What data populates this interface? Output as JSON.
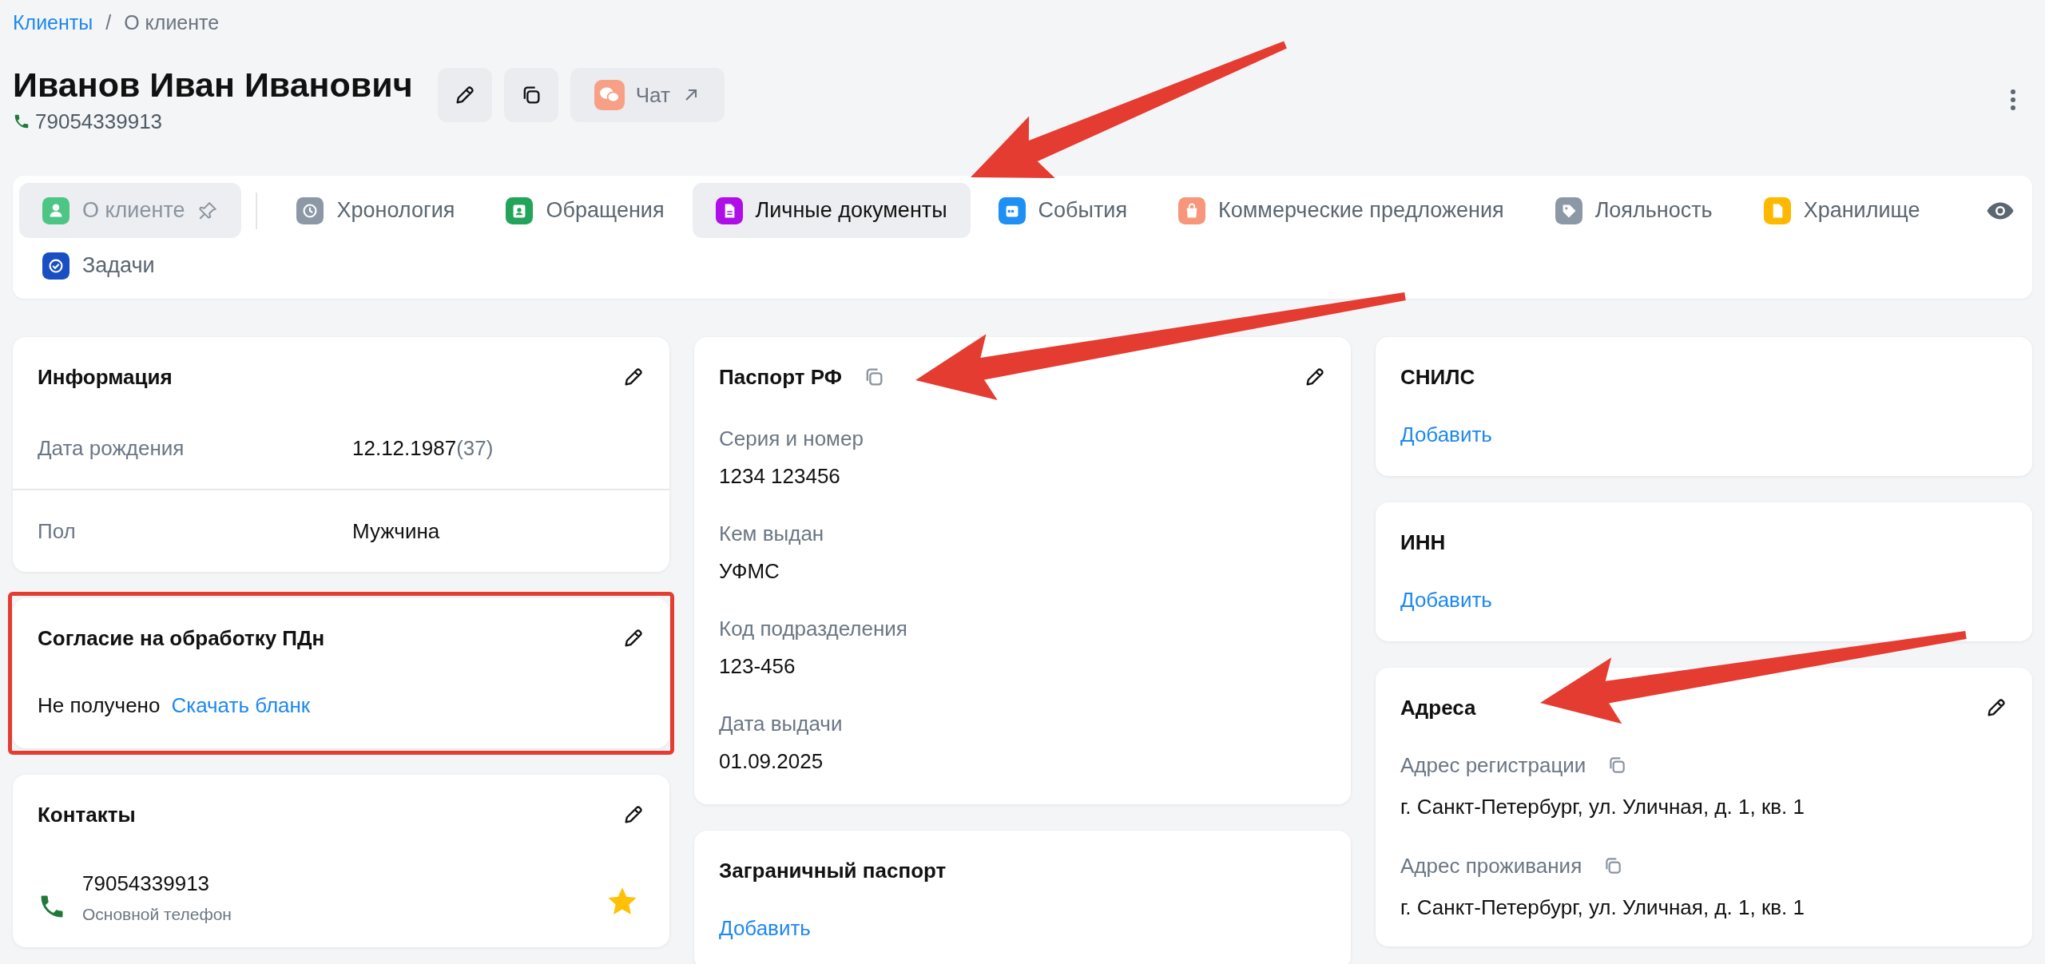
{
  "breadcrumbs": [
    {
      "label": "Клиенты",
      "kind": "link"
    },
    {
      "label": "/",
      "kind": "separator"
    },
    {
      "label": "О клиенте",
      "kind": "current"
    }
  ],
  "client": {
    "name": "Иванов Иван Иванович",
    "phone": "79054339913"
  },
  "header_actions": {
    "chat_label": "Чат"
  },
  "tab_rows": [
    [
      {
        "label": "О клиенте",
        "color": "#4cc585",
        "selected": false,
        "pinned": true
      },
      {
        "label": "Хронология",
        "color": "#8c98a6",
        "selected": false,
        "pinned": false
      },
      {
        "label": "Обращения",
        "color": "#22a45a",
        "selected": false,
        "pinned": false
      },
      {
        "label": "Личные документы",
        "color": "#b00ee8",
        "selected": true,
        "pinned": false
      },
      {
        "label": "События",
        "color": "#1e8ff5",
        "selected": false,
        "pinned": false
      },
      {
        "label": "Коммерческие предложения",
        "color": "#f7967a",
        "selected": false,
        "pinned": false
      },
      {
        "label": "Лояльность",
        "color": "#8c98a6",
        "selected": false,
        "pinned": false
      },
      {
        "label": "Хранилище",
        "color": "#ffb800",
        "selected": false,
        "pinned": false
      }
    ],
    [
      {
        "label": "Задачи",
        "color": "#1a4fc4",
        "selected": false,
        "pinned": false
      }
    ]
  ],
  "columns": [
    [
      {
        "kind": "info",
        "title": "Информация",
        "editable": true,
        "annotated": false,
        "rows": [
          {
            "label": "Дата рождения",
            "value": "12.12.1987",
            "note": "(37)"
          },
          {
            "label": "Пол",
            "value": "Мужчина"
          }
        ]
      },
      {
        "kind": "consent",
        "title": "Согласие на обработку ПДн",
        "editable": true,
        "annotated": true,
        "status": "Не получено",
        "link": "Скачать бланк"
      },
      {
        "kind": "contacts",
        "title": "Контакты",
        "editable": true,
        "annotated": false,
        "items": [
          {
            "value": "79054339913",
            "caption": "Основной телефон",
            "primary": true
          }
        ]
      }
    ],
    [
      {
        "kind": "document",
        "title": "Паспорт РФ",
        "copyable": true,
        "editable": true,
        "annotated": false,
        "fields": [
          {
            "label": "Серия и номер",
            "value": "1234 123456"
          },
          {
            "label": "Кем выдан",
            "value": "УФМС"
          },
          {
            "label": "Код подразделения",
            "value": "123-456"
          },
          {
            "label": "Дата выдачи",
            "value": "01.09.2025"
          }
        ]
      },
      {
        "kind": "empty",
        "title": "Заграничный паспорт",
        "editable": false,
        "annotated": false,
        "add_label": "Добавить"
      }
    ],
    [
      {
        "kind": "empty",
        "title": "СНИЛС",
        "editable": false,
        "annotated": false,
        "add_label": "Добавить"
      },
      {
        "kind": "empty",
        "title": "ИНН",
        "editable": false,
        "annotated": false,
        "add_label": "Добавить"
      },
      {
        "kind": "addresses",
        "title": "Адреса",
        "editable": true,
        "annotated": false,
        "fields": [
          {
            "label": "Адрес регистрации",
            "value": "г. Санкт-Петербург, ул. Уличная, д. 1, кв. 1",
            "copyable": true
          },
          {
            "label": "Адрес проживания",
            "value": "г. Санкт-Петербург, ул. Уличная, д. 1, кв. 1",
            "copyable": true
          }
        ]
      }
    ]
  ]
}
